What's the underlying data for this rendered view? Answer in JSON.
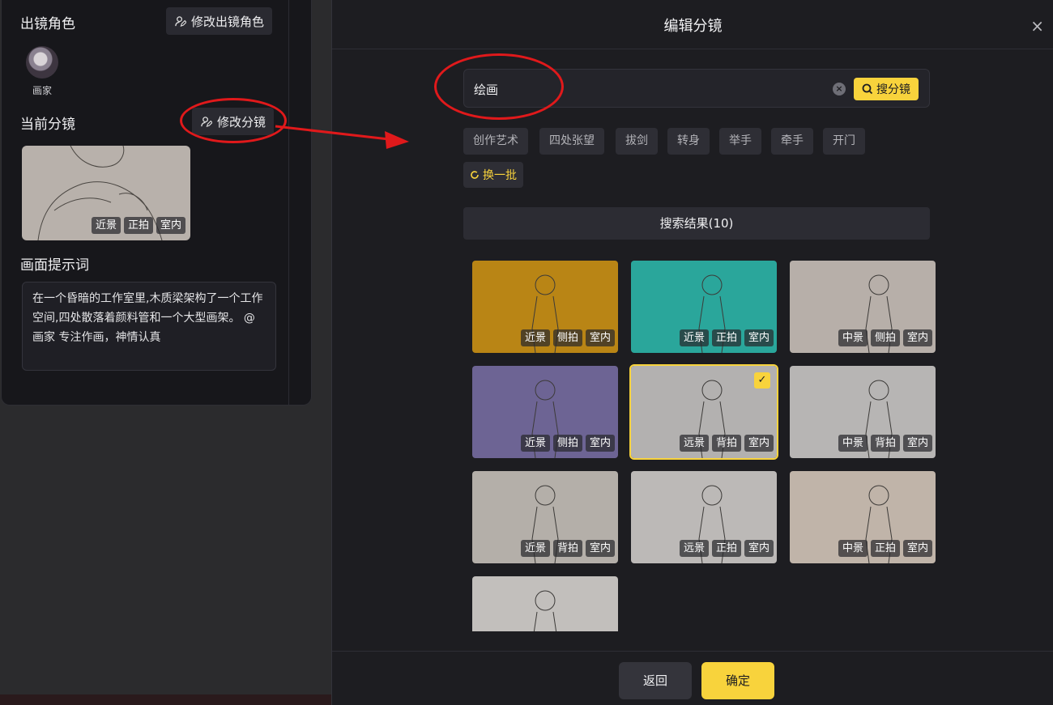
{
  "left_panel": {
    "cast_title": "出镜角色",
    "edit_cast_label": "修改出镜角色",
    "character_name": "画家",
    "current_shot_title": "当前分镜",
    "edit_shot_label": "修改分镜",
    "current_shot_tags": [
      "近景",
      "正拍",
      "室内"
    ],
    "prompt_title": "画面提示词",
    "prompt_text": "在一个昏暗的工作室里,木质梁架构了一个工作空间,四处散落着颜料管和一个大型画架。 @画家 专注作画，神情认真"
  },
  "modal": {
    "title": "编辑分镜",
    "close_label": "×",
    "search": {
      "value": "绘画",
      "button_label": "搜分镜"
    },
    "chips": [
      "创作艺术",
      "四处张望",
      "拔剑",
      "转身",
      "举手",
      "牵手",
      "开门"
    ],
    "refresh_label": "换一批",
    "results_label": "搜索结果(10)",
    "results": [
      {
        "tags": [
          "近景",
          "侧拍",
          "室内"
        ],
        "bg": "#b98515",
        "selected": false
      },
      {
        "tags": [
          "近景",
          "正拍",
          "室内"
        ],
        "bg": "#2aa69b",
        "selected": false
      },
      {
        "tags": [
          "中景",
          "侧拍",
          "室内"
        ],
        "bg": "#b7afa9",
        "selected": false
      },
      {
        "tags": [
          "近景",
          "侧拍",
          "室内"
        ],
        "bg": "#6d6494",
        "selected": false
      },
      {
        "tags": [
          "远景",
          "背拍",
          "室内"
        ],
        "bg": "#b3b1b0",
        "selected": true
      },
      {
        "tags": [
          "中景",
          "背拍",
          "室内"
        ],
        "bg": "#b7b5b4",
        "selected": false
      },
      {
        "tags": [
          "近景",
          "背拍",
          "室内"
        ],
        "bg": "#b4afa9",
        "selected": false
      },
      {
        "tags": [
          "远景",
          "正拍",
          "室内"
        ],
        "bg": "#bcb9b7",
        "selected": false
      },
      {
        "tags": [
          "中景",
          "正拍",
          "室内"
        ],
        "bg": "#c0b4a9",
        "selected": false
      },
      {
        "tags": [],
        "bg": "#c2bfbc",
        "selected": false
      }
    ],
    "back_label": "返回",
    "confirm_label": "确定"
  },
  "colors": {
    "accent": "#f8d33c",
    "annotation": "#e0191b"
  }
}
